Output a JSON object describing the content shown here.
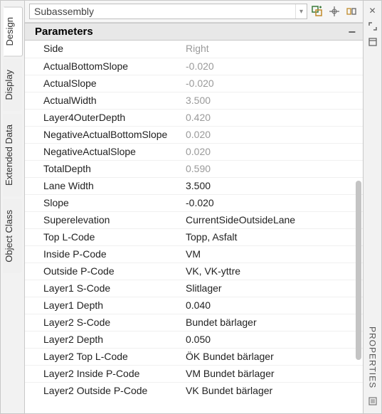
{
  "right_gutter": {
    "label": "PROPERTIES"
  },
  "left_tabs": [
    {
      "key": "design",
      "label": "Design",
      "active": true
    },
    {
      "key": "display",
      "label": "Display",
      "active": false
    },
    {
      "key": "extended",
      "label": "Extended Data",
      "active": false
    },
    {
      "key": "object",
      "label": "Object Class",
      "active": false
    }
  ],
  "toolbar": {
    "combo_value": "Subassembly"
  },
  "section": {
    "title": "Parameters"
  },
  "params": [
    {
      "name": "Side",
      "value": "Right",
      "readonly": true
    },
    {
      "name": "ActualBottomSlope",
      "value": "-0.020",
      "readonly": true
    },
    {
      "name": "ActualSlope",
      "value": "-0.020",
      "readonly": true
    },
    {
      "name": "ActualWidth",
      "value": "3.500",
      "readonly": true
    },
    {
      "name": "Layer4OuterDepth",
      "value": "0.420",
      "readonly": true
    },
    {
      "name": "NegativeActualBottomSlope",
      "value": "0.020",
      "readonly": true
    },
    {
      "name": "NegativeActualSlope",
      "value": "0.020",
      "readonly": true
    },
    {
      "name": "TotalDepth",
      "value": "0.590",
      "readonly": true
    },
    {
      "name": "Lane Width",
      "value": "3.500",
      "readonly": false
    },
    {
      "name": "Slope",
      "value": "-0.020",
      "readonly": false
    },
    {
      "name": "Superelevation",
      "value": "CurrentSideOutsideLane",
      "readonly": false
    },
    {
      "name": "Top L-Code",
      "value": "Topp, Asfalt",
      "readonly": false
    },
    {
      "name": "Inside P-Code",
      "value": "VM",
      "readonly": false
    },
    {
      "name": "Outside P-Code",
      "value": "VK, VK-yttre",
      "readonly": false
    },
    {
      "name": "Layer1 S-Code",
      "value": "Slitlager",
      "readonly": false
    },
    {
      "name": "Layer1 Depth",
      "value": "0.040",
      "readonly": false
    },
    {
      "name": "Layer2 S-Code",
      "value": "Bundet bärlager",
      "readonly": false
    },
    {
      "name": "Layer2 Depth",
      "value": "0.050",
      "readonly": false
    },
    {
      "name": "Layer2 Top L-Code",
      "value": "ÖK Bundet bärlager",
      "readonly": false
    },
    {
      "name": "Layer2 Inside P-Code",
      "value": "VM Bundet bärlager",
      "readonly": false
    },
    {
      "name": "Layer2 Outside P-Code",
      "value": "VK Bundet bärlager",
      "readonly": false
    }
  ]
}
